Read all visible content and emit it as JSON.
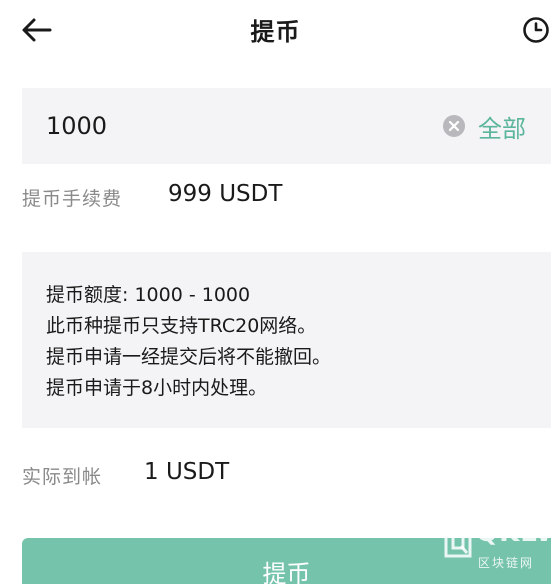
{
  "header": {
    "title": "提币",
    "back_icon": "arrow-left-icon",
    "history_icon": "clock-icon"
  },
  "amount": {
    "value": "1000",
    "clear_icon": "clear-icon",
    "all_label": "全部"
  },
  "fee": {
    "label": "提币手续费",
    "value": "999 USDT"
  },
  "info": {
    "lines": [
      "提币额度: 1000 - 1000",
      "此币种提币只支持TRC20网络。",
      "提币申请一经提交后将不能撤回。",
      "提币申请于8小时内处理。"
    ]
  },
  "received": {
    "label": "实际到帐",
    "value": "1 USDT"
  },
  "submit": {
    "label": "提币"
  },
  "watermark": {
    "brand": "QKLW",
    "sub": "区块链网"
  },
  "colors": {
    "accent": "#5bb59b",
    "button_bg": "#76c3ab",
    "panel_bg": "#f4f4f6",
    "muted_text": "#8a8a8a"
  }
}
